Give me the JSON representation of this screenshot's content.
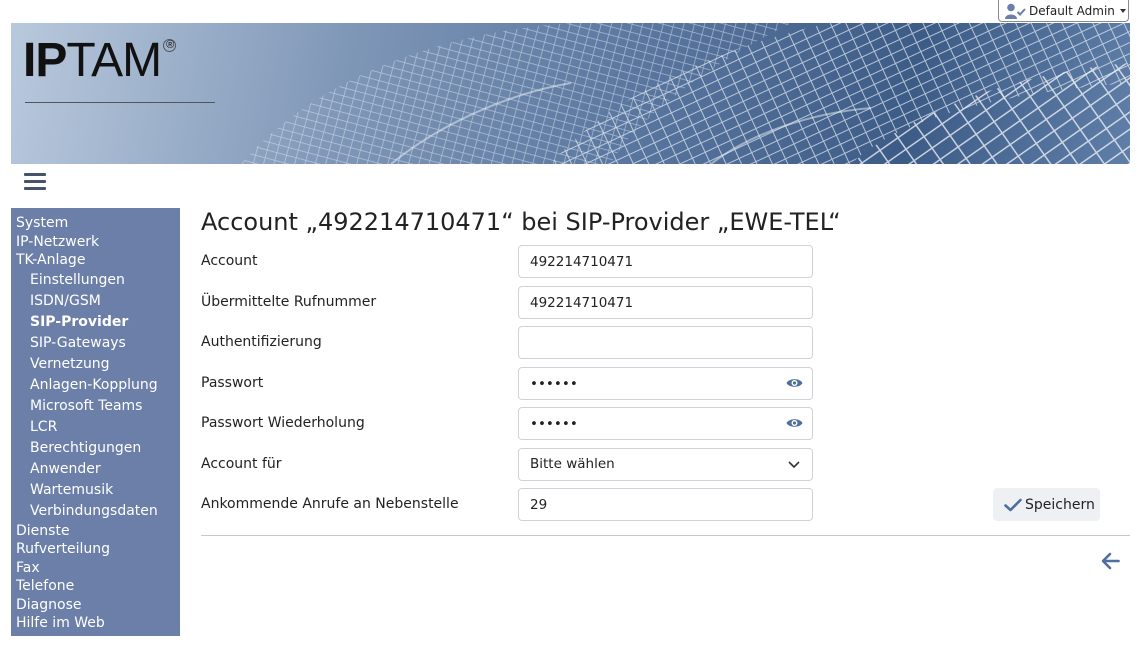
{
  "header": {
    "user_label": "Default Admin",
    "user_icon": "user-check-icon",
    "logo_text_bold": "IP",
    "logo_text": "TAM",
    "logo_mark": "®"
  },
  "sidebar": {
    "menu_icon": "hamburger-icon",
    "items": [
      {
        "label": "System"
      },
      {
        "label": "IP-Netzwerk"
      },
      {
        "label": "TK-Anlage"
      },
      {
        "label": "Dienste"
      },
      {
        "label": "Rufverteilung"
      },
      {
        "label": "Fax"
      },
      {
        "label": "Telefone"
      },
      {
        "label": "Diagnose"
      },
      {
        "label": "Hilfe im Web"
      }
    ],
    "subitems": [
      {
        "label": "Einstellungen"
      },
      {
        "label": "ISDN/GSM"
      },
      {
        "label": "SIP-Provider",
        "active": true
      },
      {
        "label": "SIP-Gateways"
      },
      {
        "label": "Vernetzung"
      },
      {
        "label": "Anlagen-Kopplung"
      },
      {
        "label": "Microsoft Teams"
      },
      {
        "label": "LCR"
      },
      {
        "label": "Berechtigungen"
      },
      {
        "label": "Anwender"
      },
      {
        "label": "Wartemusik"
      },
      {
        "label": "Verbindungsdaten"
      }
    ]
  },
  "main": {
    "title": "Account „492214710471“ bei SIP-Provider „EWE-TEL“",
    "form": {
      "account_label": "Account",
      "account_value": "492214710471",
      "number_label": "Übermittelte Rufnummer",
      "number_value": "492214710471",
      "auth_label": "Authentifizierung",
      "auth_value": "",
      "password_label": "Passwort",
      "password_value": "••••••",
      "password_repeat_label": "Passwort Wiederholung",
      "password_repeat_value": "••••••",
      "account_for_label": "Account für",
      "account_for_value": "Bitte wählen",
      "extension_label": "Ankommende Anrufe an Nebenstelle",
      "extension_value": "29"
    },
    "save_label": "Speichern",
    "save_icon": "checkmark-icon",
    "back_icon": "arrow-left-icon",
    "eye_icon": "eye-icon",
    "dropdown_icon": "chevron-down-icon"
  },
  "colors": {
    "sidebar_bg": "#6b7fa8",
    "accent": "#4f6f9c",
    "button_bg": "#eef0f3"
  }
}
